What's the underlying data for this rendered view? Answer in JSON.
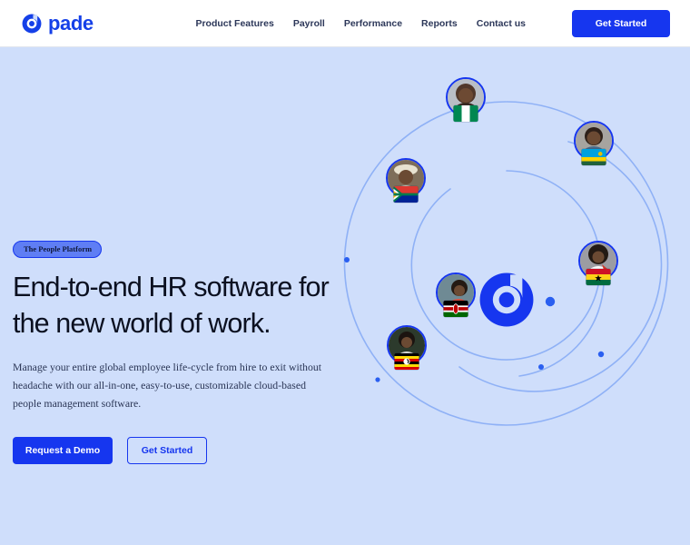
{
  "brand": {
    "name": "pade",
    "logo_icon": "pade-circle-mark",
    "color": "#1540e8"
  },
  "header": {
    "nav": [
      {
        "label": "Product Features"
      },
      {
        "label": "Payroll"
      },
      {
        "label": "Performance"
      },
      {
        "label": "Reports"
      },
      {
        "label": "Contact us"
      }
    ],
    "cta_label": "Get Started",
    "cta_color": "#1636ef"
  },
  "hero": {
    "badge": "The People Platform",
    "headline": "End-to-end HR software for the new world of work.",
    "subcopy": "Manage your entire global employee life-cycle from hire to exit without headache with our all-in-one, easy-to-use, customizable cloud-based people management software.",
    "primary_cta": "Request a Demo",
    "secondary_cta": "Get Started",
    "background": "#cfdefb",
    "accent": "#1636ef"
  },
  "orbit": {
    "center_icon": "pade-circle-mark",
    "avatars": [
      {
        "name": "avatar-nigeria",
        "country": "Nigeria",
        "flag": "NG"
      },
      {
        "name": "avatar-rwanda",
        "country": "Rwanda",
        "flag": "RW"
      },
      {
        "name": "avatar-south-africa",
        "country": "South Africa",
        "flag": "ZA"
      },
      {
        "name": "avatar-ghana",
        "country": "Ghana",
        "flag": "GH"
      },
      {
        "name": "avatar-kenya",
        "country": "Kenya",
        "flag": "KE"
      },
      {
        "name": "avatar-uganda",
        "country": "Uganda",
        "flag": "UG"
      }
    ]
  }
}
